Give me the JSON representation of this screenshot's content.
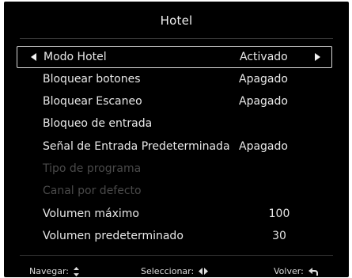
{
  "header": {
    "title": "Hotel"
  },
  "menu": {
    "items": [
      {
        "label": "Modo Hotel",
        "value": "Activado"
      },
      {
        "label": "Bloquear botones",
        "value": "Apagado"
      },
      {
        "label": "Bloquear Escaneo",
        "value": "Apagado"
      },
      {
        "label": "Bloqueo de entrada",
        "value": ""
      },
      {
        "label": "Señal de Entrada Predeterminada",
        "value": "Apagado"
      },
      {
        "label": "Tipo de programa",
        "value": ""
      },
      {
        "label": "Canal por defecto",
        "value": ""
      },
      {
        "label": "Volumen máximo",
        "value": "100"
      },
      {
        "label": "Volumen predeterminado",
        "value": "30"
      }
    ]
  },
  "footer": {
    "navigate_label": "Navegar:",
    "select_label": "Seleccionar:",
    "back_label": "Volver:"
  },
  "colors": {
    "background": "#000000",
    "text": "#e9e9e9",
    "disabled_text": "#4a4a4a",
    "selection_border": "#d8d8d8"
  },
  "icons": {
    "navigate": "up-down-arrows-icon",
    "select": "left-right-arrows-icon",
    "back": "return-arrow-icon"
  }
}
